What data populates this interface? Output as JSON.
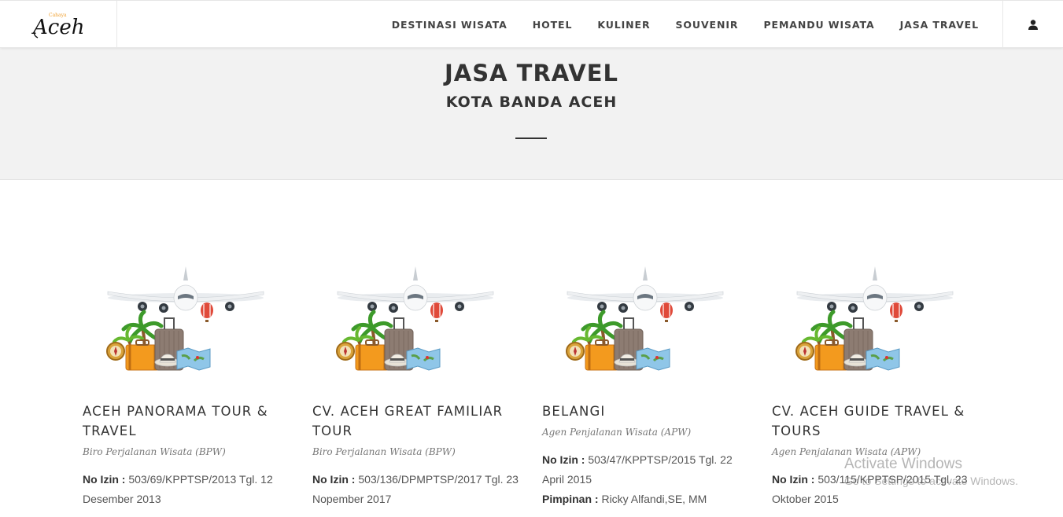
{
  "brand": {
    "script": "Aceh",
    "tag": "Cahaya"
  },
  "nav": {
    "items": [
      "DESTINASI WISATA",
      "HOTEL",
      "KULINER",
      "SOUVENIR",
      "PEMANDU WISATA",
      "JASA TRAVEL"
    ],
    "user_icon": "user-icon"
  },
  "hero": {
    "title": "JASA TRAVEL",
    "subtitle": "KOTA BANDA ACEH"
  },
  "cards": [
    {
      "name": "ACEH PANORAMA TOUR & TRAVEL",
      "category": "Biro Perjalanan Wisata (BPW)",
      "izin_label": "No Izin :",
      "izin": "503/69/KPPTSP/2013 Tgl. 12 Desember 2013"
    },
    {
      "name": "CV. ACEH GREAT FAMILIAR TOUR",
      "category": "Biro Perjalanan Wisata (BPW)",
      "izin_label": "No Izin :",
      "izin": "503/136/DPMPTSP/2017 Tgl. 23 Nopember 2017"
    },
    {
      "name": "BELANGI",
      "category": "Agen Penjalanan Wisata (APW)",
      "izin_label": "No Izin :",
      "izin": "503/47/KPPTSP/2015 Tgl. 22 April 2015",
      "pimpinan_label": "Pimpinan :",
      "pimpinan": "Ricky Alfandi,SE, MM"
    },
    {
      "name": "CV. ACEH GUIDE TRAVEL & TOURS",
      "category": "Agen Penjalanan Wisata (APW)",
      "izin_label": "No Izin :",
      "izin": "503/115/KPPTSP/2015 Tgl. 23 Oktober 2015"
    }
  ],
  "watermark": {
    "line1": "Activate Windows",
    "line2": "Go to Settings to activate Windows."
  },
  "colors": {
    "accent": "#f0a030",
    "hero_bg": "#f2f2f2",
    "text": "#333333"
  }
}
